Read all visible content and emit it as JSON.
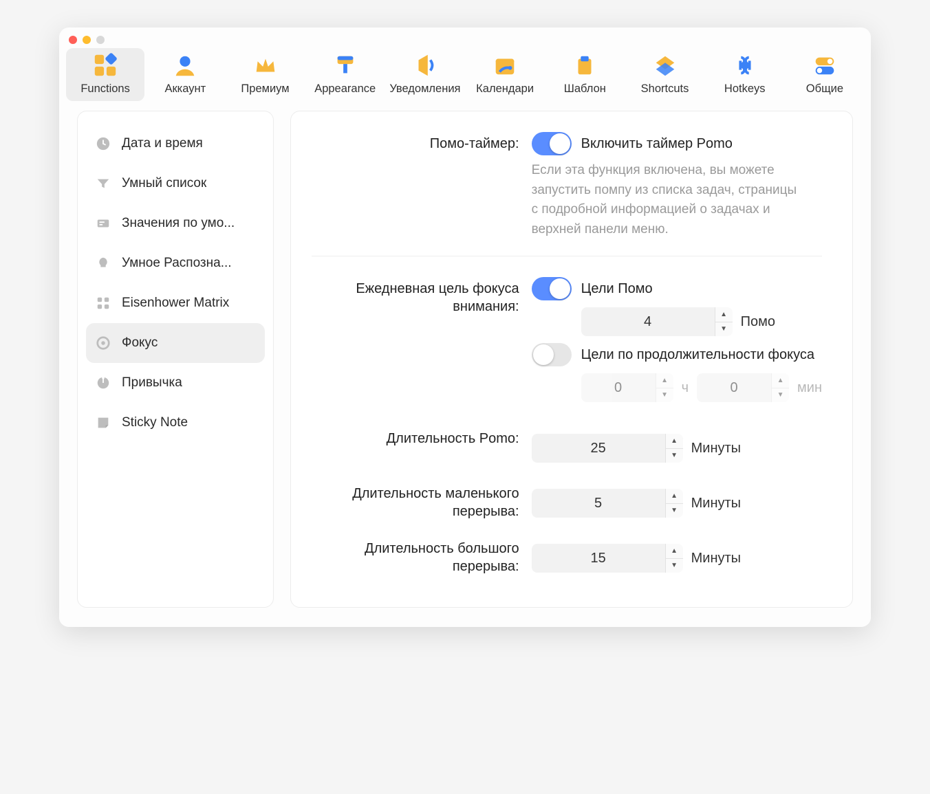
{
  "toolbar": [
    {
      "key": "functions",
      "label": "Functions"
    },
    {
      "key": "account",
      "label": "Аккаунт"
    },
    {
      "key": "premium",
      "label": "Премиум"
    },
    {
      "key": "appearance",
      "label": "Appearance"
    },
    {
      "key": "notifications",
      "label": "Уведомления"
    },
    {
      "key": "calendars",
      "label": "Календари"
    },
    {
      "key": "template",
      "label": "Шаблон"
    },
    {
      "key": "shortcuts",
      "label": "Shortcuts"
    },
    {
      "key": "hotkeys",
      "label": "Hotkeys"
    },
    {
      "key": "general",
      "label": "Общие"
    }
  ],
  "sidebar": {
    "items": [
      {
        "key": "datetime",
        "label": "Дата и время"
      },
      {
        "key": "smartlist",
        "label": "Умный список"
      },
      {
        "key": "defaults",
        "label": "Значения по умо..."
      },
      {
        "key": "smartrecog",
        "label": "Умное Распозна..."
      },
      {
        "key": "eisenhower",
        "label": "Eisenhower Matrix"
      },
      {
        "key": "focus",
        "label": "Фокус"
      },
      {
        "key": "habit",
        "label": "Привычка"
      },
      {
        "key": "sticky",
        "label": "Sticky Note"
      }
    ]
  },
  "content": {
    "pomo_timer_label": "Помо-таймер:",
    "pomo_enable_label": "Включить таймер Pomo",
    "pomo_desc": "Если эта функция включена, вы можете запустить помпу из списка задач, страницы с подробной информацией о задачах и верхней панели меню.",
    "daily_goal_label": "Ежедневная цель фокуса внимания:",
    "pomo_goals_label": "Цели Помо",
    "pomo_goals_value": "4",
    "pomo_goals_unit": "Помо",
    "duration_goals_label": "Цели по продолжительности фокуса",
    "duration_hours_value": "0",
    "duration_hours_unit": "ч",
    "duration_mins_value": "0",
    "duration_mins_unit": "мин",
    "pomo_length_label": "Длительность Pomo:",
    "pomo_length_value": "25",
    "short_break_label": "Длительность маленького перерыва:",
    "short_break_value": "5",
    "long_break_label": "Длительность большого перерыва:",
    "long_break_value": "15",
    "minutes_unit": "Минуты"
  }
}
